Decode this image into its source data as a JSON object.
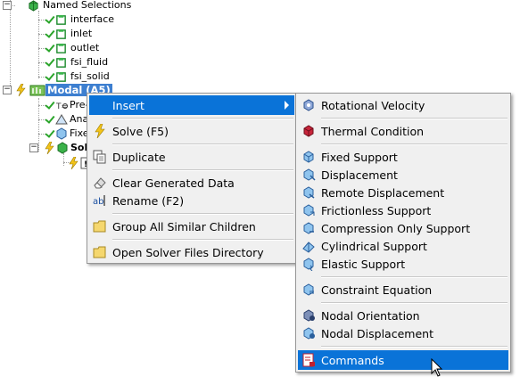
{
  "tree": {
    "named_selections": "Named Selections",
    "children": [
      "interface",
      "inlet",
      "outlet",
      "fsi_fluid",
      "fsi_solid"
    ],
    "modal": "Modal (A5)",
    "modal_children": [
      "Pre-",
      "Ana",
      "Fixe"
    ],
    "solution": "Sol"
  },
  "context_menu": {
    "items": [
      {
        "label": "Insert",
        "icon": "insert-icon"
      },
      {
        "label": "Solve (F5)",
        "icon": "lightning-icon"
      },
      {
        "label": "Duplicate",
        "icon": "duplicate-icon"
      },
      {
        "label": "Clear Generated Data",
        "icon": "eraser-icon"
      },
      {
        "label": "Rename (F2)",
        "icon": "rename-icon"
      },
      {
        "label": "Group All Similar Children",
        "icon": "folder-icon"
      },
      {
        "label": "Open Solver Files Directory",
        "icon": "folder-icon"
      }
    ]
  },
  "submenu": {
    "items": [
      {
        "label": "Rotational Velocity"
      },
      {
        "label": "Thermal Condition"
      },
      {
        "label": "Fixed Support"
      },
      {
        "label": "Displacement"
      },
      {
        "label": "Remote Displacement"
      },
      {
        "label": "Frictionless Support"
      },
      {
        "label": "Compression Only Support"
      },
      {
        "label": "Cylindrical Support"
      },
      {
        "label": "Elastic Support"
      },
      {
        "label": "Constraint Equation"
      },
      {
        "label": "Nodal Orientation"
      },
      {
        "label": "Nodal Displacement"
      },
      {
        "label": "Commands"
      }
    ]
  },
  "colors": {
    "highlight": "#0a73d8",
    "menu_bg": "#f0f0f0",
    "tree_selected": "#3d7fd0"
  }
}
